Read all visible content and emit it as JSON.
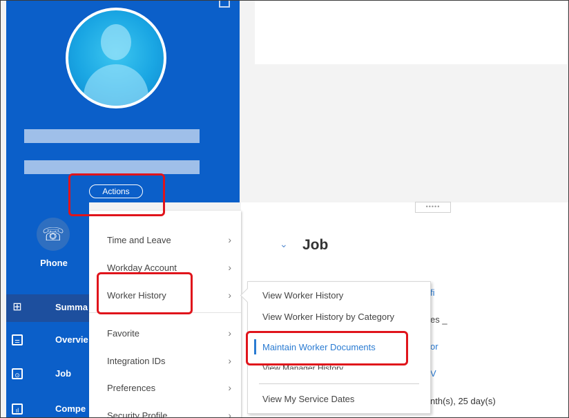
{
  "profile": {
    "actions_label": "Actions"
  },
  "left_nav": {
    "phone_label": "Phone",
    "items": [
      {
        "label": "Summa",
        "icon": "summary-grid-icon"
      },
      {
        "label": "Overvie",
        "icon": "overview-doc-icon"
      },
      {
        "label": "Job",
        "icon": "briefcase-icon"
      },
      {
        "label": "Compe",
        "icon": "bar-chart-icon"
      }
    ]
  },
  "content": {
    "section_title": "Job",
    "peeks": [
      "fi",
      "es _",
      "or",
      "V",
      "nth(s), 25 day(s)"
    ]
  },
  "actions_menu": {
    "items": [
      {
        "label": "Time and Leave"
      },
      {
        "label": "Workday Account"
      },
      {
        "label": "Worker History"
      },
      {
        "label": "Favorite"
      },
      {
        "label": "Integration IDs"
      },
      {
        "label": "Preferences"
      },
      {
        "label": "Security Profile"
      }
    ]
  },
  "submenu": {
    "items": [
      {
        "label": "View Worker History"
      },
      {
        "label": "View Worker History by Category"
      },
      {
        "label": "Maintain Worker Documents"
      },
      {
        "label": "View Manager History"
      },
      {
        "label": "View My Service Dates"
      }
    ]
  },
  "colors": {
    "brand_blue": "#0b5fc9",
    "highlight_red": "#e0141b",
    "link_blue": "#2a7bd2"
  }
}
